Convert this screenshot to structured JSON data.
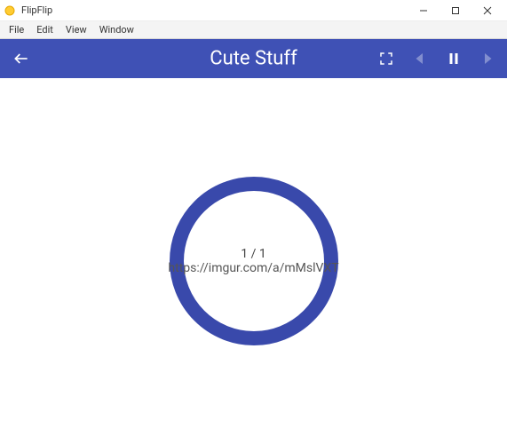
{
  "window": {
    "app_title": "FlipFlip",
    "menu": {
      "file": "File",
      "edit": "Edit",
      "view": "View",
      "window": "Window"
    }
  },
  "appbar": {
    "title": "Cute Stuff"
  },
  "progress": {
    "counter": "1 / 1",
    "url": "https://imgur.com/a/mMslVXT"
  },
  "colors": {
    "primary": "#3f51b5"
  }
}
